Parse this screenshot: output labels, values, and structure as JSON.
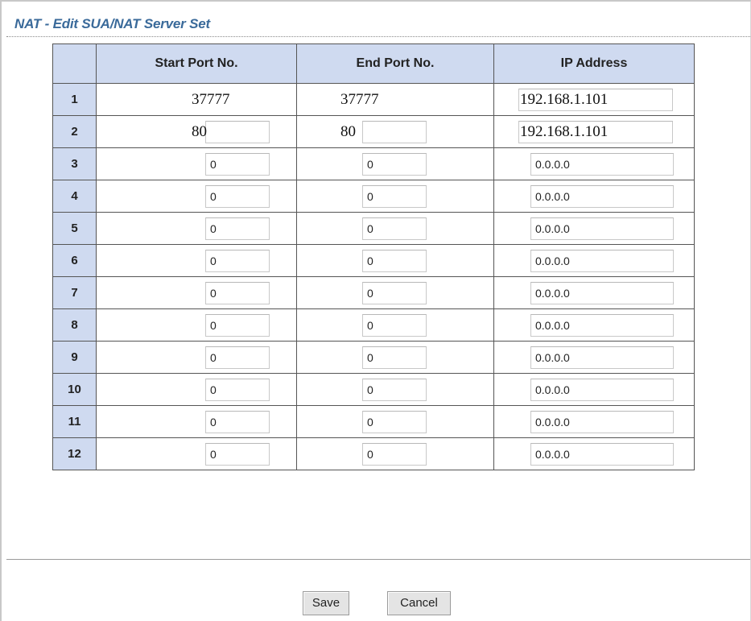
{
  "page": {
    "title": "NAT - Edit SUA/NAT Server Set"
  },
  "table": {
    "headers": {
      "index": "",
      "start_port": "Start Port No.",
      "end_port": "End Port No.",
      "ip_address": "IP Address"
    },
    "rows": [
      {
        "index": "1",
        "start_port": "37777",
        "end_port": "37777",
        "ip_address": "192.168.1.101"
      },
      {
        "index": "2",
        "start_port": "80",
        "end_port": "80",
        "ip_address": "192.168.1.101"
      },
      {
        "index": "3",
        "start_port": "0",
        "end_port": "0",
        "ip_address": "0.0.0.0"
      },
      {
        "index": "4",
        "start_port": "0",
        "end_port": "0",
        "ip_address": "0.0.0.0"
      },
      {
        "index": "5",
        "start_port": "0",
        "end_port": "0",
        "ip_address": "0.0.0.0"
      },
      {
        "index": "6",
        "start_port": "0",
        "end_port": "0",
        "ip_address": "0.0.0.0"
      },
      {
        "index": "7",
        "start_port": "0",
        "end_port": "0",
        "ip_address": "0.0.0.0"
      },
      {
        "index": "8",
        "start_port": "0",
        "end_port": "0",
        "ip_address": "0.0.0.0"
      },
      {
        "index": "9",
        "start_port": "0",
        "end_port": "0",
        "ip_address": "0.0.0.0"
      },
      {
        "index": "10",
        "start_port": "0",
        "end_port": "0",
        "ip_address": "0.0.0.0"
      },
      {
        "index": "11",
        "start_port": "0",
        "end_port": "0",
        "ip_address": "0.0.0.0"
      },
      {
        "index": "12",
        "start_port": "0",
        "end_port": "0",
        "ip_address": "0.0.0.0"
      }
    ]
  },
  "buttons": {
    "save": "Save",
    "cancel": "Cancel"
  },
  "colors": {
    "title": "#3a6a9a",
    "header_bg": "#cfdaf0"
  }
}
